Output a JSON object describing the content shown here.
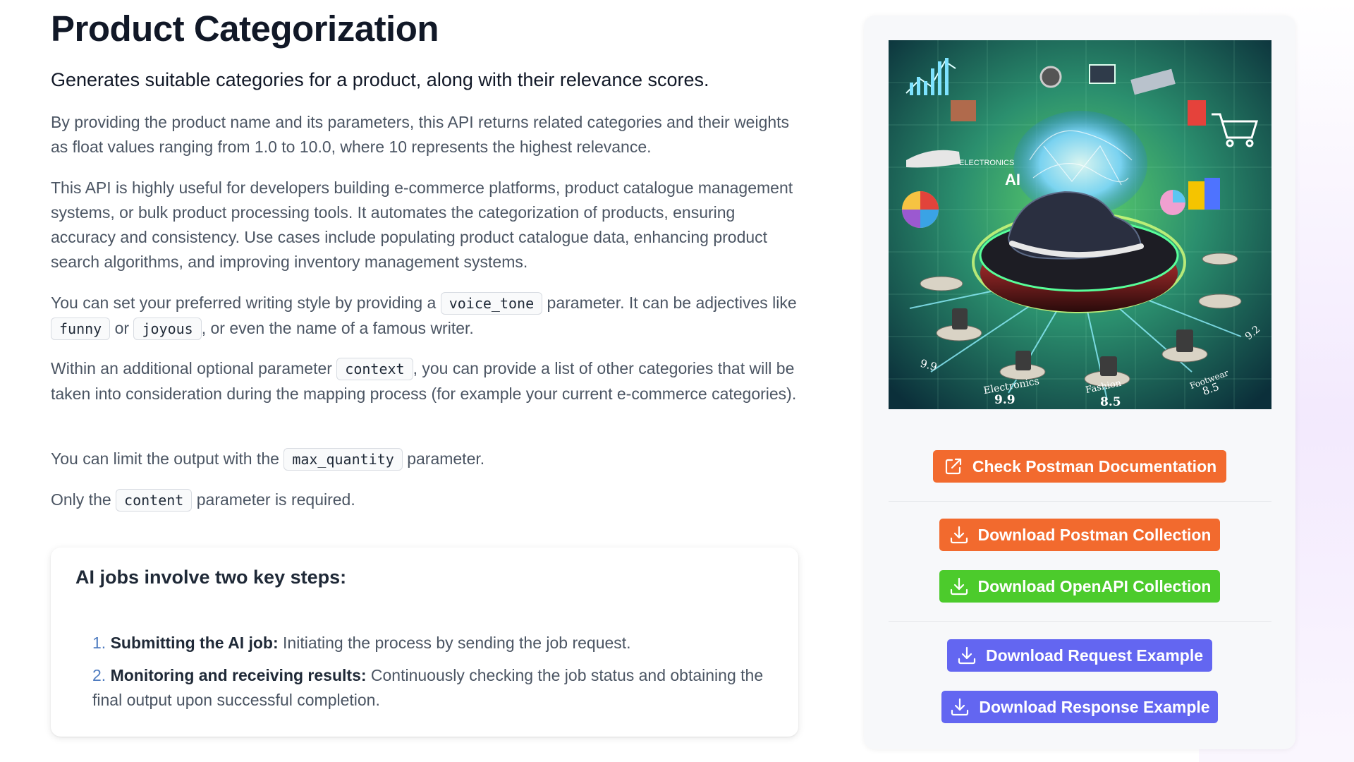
{
  "header": {
    "title": "Product Categorization",
    "subtitle": "Generates suitable categories for a product, along with their relevance scores."
  },
  "description": {
    "p1": "By providing the product name and its parameters, this API returns related categories and their weights as float values ranging from 1.0 to 10.0, where 10 represents the highest relevance.",
    "p2": "This API is highly useful for developers building e-commerce platforms, product catalogue management systems, or bulk product processing tools. It automates the categorization of products, ensuring accuracy and consistency. Use cases include populating product catalogue data, enhancing product search algorithms, and improving inventory management systems.",
    "p3": {
      "text_a": "You can set your preferred writing style by providing a ",
      "code_a": "voice_tone",
      "text_b": " parameter. It can be adjectives like ",
      "code_b": "funny",
      "text_c": " or ",
      "code_c": "joyous",
      "text_d": ", or even the name of a famous writer."
    },
    "p4": {
      "text_a": "Within an additional optional parameter ",
      "code_a": "context",
      "text_b": ", you can provide a list of other categories that will be taken into consideration during the mapping process (for example your current e-commerce categories)."
    },
    "p5": {
      "text_a": "You can limit the output with the ",
      "code_a": "max_quantity",
      "text_b": " parameter."
    },
    "p6": {
      "text_a": "Only the ",
      "code_a": "content",
      "text_b": " parameter is required."
    }
  },
  "steps": {
    "heading": "AI jobs involve two key steps:",
    "items": [
      {
        "num": "1.",
        "bold": "Submitting the AI job:",
        "text": " Initiating the process by sending the job request."
      },
      {
        "num": "2.",
        "bold": "Monitoring and receiving results:",
        "text": " Continuously checking the job status and obtaining the final output upon successful completion."
      }
    ]
  },
  "hero": {
    "label_electronics": "ELECTRONICS",
    "label_ai": "AI",
    "label_bottom_electronics": "Electronics",
    "score_electronics": "9.9",
    "label_bottom_fashion": "Fashion",
    "score_fashion": "8.5",
    "label_footwear": "Footwear",
    "score_footwear": "8.5",
    "score_left": "9.9",
    "score_right": "9.2"
  },
  "buttons": {
    "postman_docs": "Check Postman Documentation",
    "postman_collection": "Download Postman Collection",
    "openapi_collection": "Download OpenAPI Collection",
    "request_example": "Download Request Example",
    "response_example": "Download Response Example"
  },
  "colors": {
    "orange": "#f26a2e",
    "green": "#4ccb2c",
    "indigo": "#6366f1",
    "title": "#111827",
    "body_text": "#4b5563",
    "step_number": "#4f7cc0"
  }
}
